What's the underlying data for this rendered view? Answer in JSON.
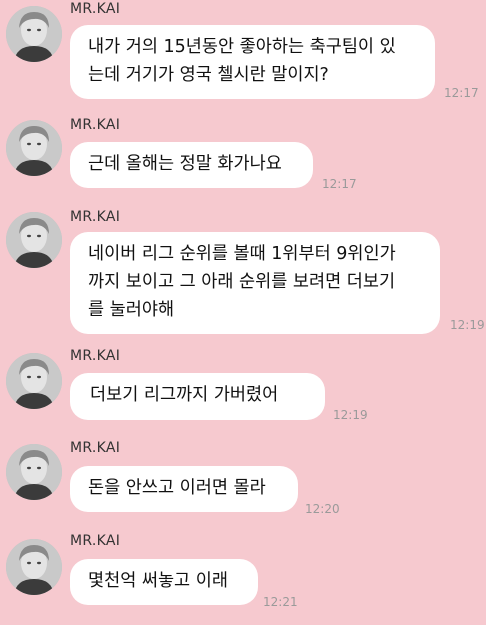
{
  "messages": [
    {
      "sender": "MR.KAI",
      "text": "내가 거의 15년동안 좋아하는 축구팀이 있\n는데 거기가 영국 첼시란 말이지?",
      "time": "12:17"
    },
    {
      "sender": "MR.KAI",
      "text": "근데 올해는 정말 화가나요",
      "time": "12:17"
    },
    {
      "sender": "MR.KAI",
      "text": "네이버 리그 순위를 볼때 1위부터 9위인가\n까지 보이고 그 아래 순위를 보려면 더보기\n를 눌러야해",
      "time": "12:19"
    },
    {
      "sender": "MR.KAI",
      "text": "더보기 리그까지 가버렸어",
      "time": "12:19"
    },
    {
      "sender": "MR.KAI",
      "text": "돈을 안쓰고 이러면 몰라",
      "time": "12:20"
    },
    {
      "sender": "MR.KAI",
      "text": "몇천억 써놓고 이래",
      "time": "12:21"
    }
  ]
}
